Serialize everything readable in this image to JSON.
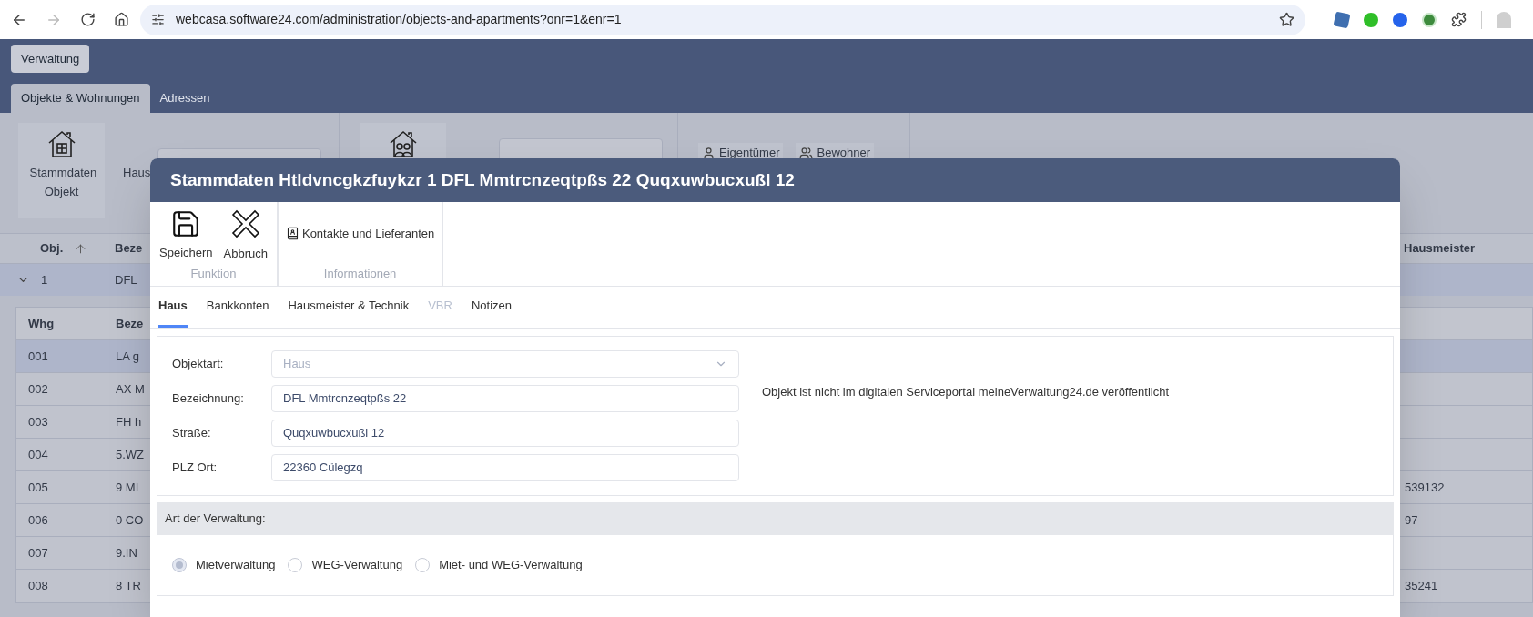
{
  "browser": {
    "url": "webcasa.software24.com/administration/objects-and-apartments?onr=1&enr=1",
    "forward_disabled": true
  },
  "app": {
    "menu_button": "Verwaltung",
    "tabs": [
      {
        "label": "Objekte & Wohnungen",
        "selected": true
      },
      {
        "label": "Adressen",
        "selected": false
      }
    ],
    "ribbon": {
      "object_button": "Stammdaten Objekt",
      "field_label": "Haus",
      "buttons": [
        {
          "kind": "owner",
          "label": "Eigentümer"
        },
        {
          "kind": "residents",
          "label": "Bewohner"
        }
      ]
    },
    "table": {
      "columns": [
        "Obj.",
        "Beze",
        "Hausmeister"
      ],
      "rows": [
        {
          "cells": [
            "1",
            "DFL"
          ],
          "expanded": true,
          "selected": true
        }
      ]
    },
    "subtable": {
      "columns": [
        "Whg",
        "Beze"
      ],
      "rows": [
        {
          "cells": [
            "001",
            "LA g",
            ""
          ],
          "selected": true
        },
        {
          "cells": [
            "002",
            "AX M",
            ""
          ],
          "selected": false
        },
        {
          "cells": [
            "003",
            "FH h",
            ""
          ],
          "selected": false
        },
        {
          "cells": [
            "004",
            "5.WZ",
            ""
          ],
          "selected": false
        },
        {
          "cells": [
            "005",
            "9 MI",
            "539132"
          ],
          "selected": false
        },
        {
          "cells": [
            "006",
            "0 CO",
            "97"
          ],
          "selected": false
        },
        {
          "cells": [
            "007",
            "9.IN",
            ""
          ],
          "selected": false
        },
        {
          "cells": [
            "008",
            "8 TR",
            "35241"
          ],
          "selected": false
        }
      ]
    }
  },
  "dialog": {
    "title": "Stammdaten Htldvncgkzfuykzr 1 DFL Mmtrcnzeqtpßs 22 Quqxuwbucxußl 12",
    "toolbar": [
      {
        "label": "Funktion",
        "buttons": [
          {
            "kind": "save",
            "label": "Speichern"
          },
          {
            "kind": "cancel",
            "label": "Abbruch"
          }
        ]
      },
      {
        "label": "Informationen",
        "buttons": [
          {
            "kind": "contacts",
            "label": "Kontakte und Lieferanten"
          }
        ]
      }
    ],
    "tabs": [
      {
        "label": "Haus",
        "selected": true,
        "disabled": false
      },
      {
        "label": "Bankkonten",
        "selected": false,
        "disabled": false
      },
      {
        "label": "Hausmeister & Technik",
        "selected": false,
        "disabled": false
      },
      {
        "label": "VBR",
        "selected": false,
        "disabled": true
      },
      {
        "label": "Notizen",
        "selected": false,
        "disabled": false
      }
    ],
    "fields": [
      {
        "kind": "select",
        "label": "Objektart:",
        "value": "Haus",
        "disabled": true
      },
      {
        "kind": "text",
        "label": "Bezeichnung:",
        "value": "DFL Mmtrcnzeqtpßs 22",
        "disabled": false
      },
      {
        "kind": "text",
        "label": "Straße:",
        "value": "Quqxuwbucxußl 12",
        "disabled": false
      },
      {
        "kind": "text",
        "label": "PLZ Ort:",
        "value": "22360 Cülegzq",
        "disabled": false
      }
    ],
    "notice": "Objekt ist nicht im digitalen Serviceportal meineVerwaltung24.de veröffentlicht",
    "section": {
      "title": "Art der Verwaltung:",
      "options": [
        {
          "label": "Mietverwaltung",
          "selected": true
        },
        {
          "label": "WEG-Verwaltung",
          "selected": false
        },
        {
          "label": "Miet- und WEG-Verwaltung",
          "selected": false
        }
      ]
    }
  }
}
